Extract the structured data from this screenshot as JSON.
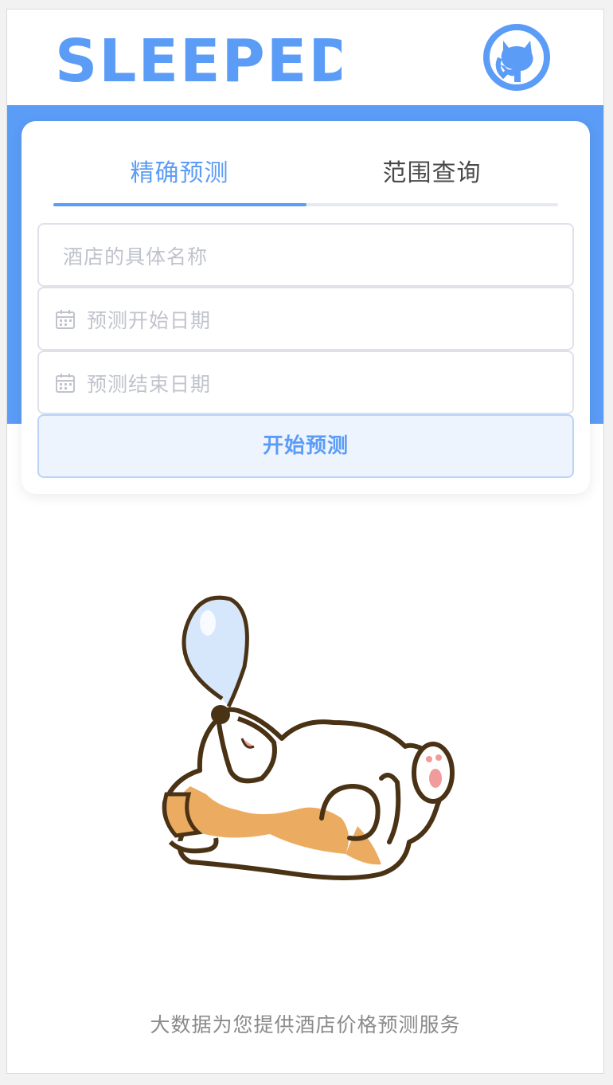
{
  "brand": {
    "name": "SLEEPED",
    "color": "#5b9cf6"
  },
  "header": {
    "github_icon": "github-icon"
  },
  "tabs": [
    {
      "label": "精确预测",
      "active": true
    },
    {
      "label": "范围查询",
      "active": false
    }
  ],
  "form": {
    "hotel_name_placeholder": "酒店的具体名称",
    "start_date_placeholder": "预测开始日期",
    "end_date_placeholder": "预测结束日期",
    "calendar_icon": "calendar-icon",
    "submit_label": "开始预测"
  },
  "illustration": {
    "icon": "sleeping-corgi-illustration"
  },
  "footer": {
    "text": "大数据为您提供酒店价格预测服务"
  },
  "colors": {
    "accent": "#5b9cf6",
    "button_bg": "#edf4fe",
    "placeholder": "#c0c3cc",
    "footer_text": "#8a8a8a"
  }
}
